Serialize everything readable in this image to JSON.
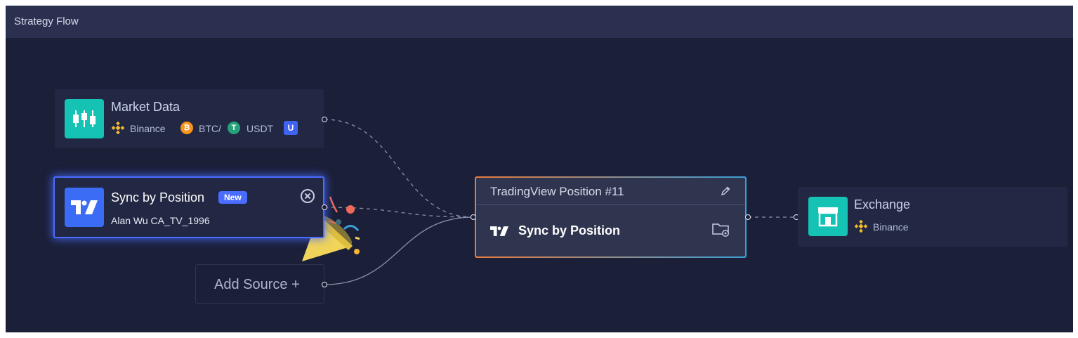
{
  "panel": {
    "title": "Strategy Flow"
  },
  "nodes": {
    "market_data": {
      "title": "Market Data",
      "exchange": "Binance",
      "base": "BTC/",
      "quote": "USDT",
      "tag": "U",
      "icon": "candlestick-icon"
    },
    "sync_source": {
      "title": "Sync by Position",
      "badge": "New",
      "account": "Alan Wu CA_TV_1996",
      "icon": "tradingview-logo-icon"
    },
    "add_source": {
      "label": "Add Source +"
    },
    "tradingview": {
      "header": "TradingView Position #11",
      "body": "Sync by Position",
      "icon": "tradingview-logo-icon"
    },
    "exchange": {
      "title": "Exchange",
      "name": "Binance",
      "icon": "storefront-icon"
    }
  },
  "colors": {
    "panel_bg": "#1b1f38",
    "titlebar_bg": "#2c3050",
    "node_bg": "#222843",
    "accent_blue": "#4a6cff",
    "teal": "#14c3b3",
    "binance": "#f3ba2f",
    "bitcoin": "#f7931a",
    "tether": "#26a17b",
    "gradient_start": "#ea7b3c",
    "gradient_end": "#3a9fd8"
  }
}
